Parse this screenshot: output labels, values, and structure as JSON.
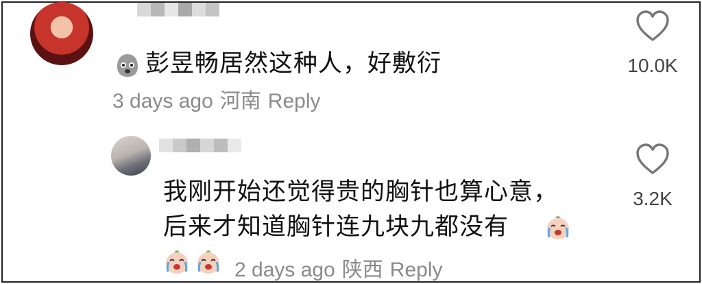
{
  "comments": [
    {
      "text": "彭昱畅居然这种人，好敷衍",
      "time": "3 days ago",
      "location": "河南",
      "reply_label": "Reply",
      "likes": "10.0K",
      "leading_emoji": "ghost-emoji-icon"
    },
    {
      "text_line1": "我刚开始还觉得贵的胸针也算心意，",
      "text_line2": "后来才知道胸针连九块九都没有",
      "time": "2 days ago",
      "location": "陕西",
      "reply_label": "Reply",
      "likes": "3.2K",
      "trailing_emoji": "crying-face-emoji-icon",
      "meta_emojis": [
        "crying-face-emoji-icon",
        "crying-face-emoji-icon"
      ]
    }
  ],
  "icons": {
    "like": "heart-outline-icon"
  },
  "colors": {
    "text": "#111111",
    "meta": "#8a8a8a",
    "like_count": "#444444",
    "border": "#222222"
  }
}
